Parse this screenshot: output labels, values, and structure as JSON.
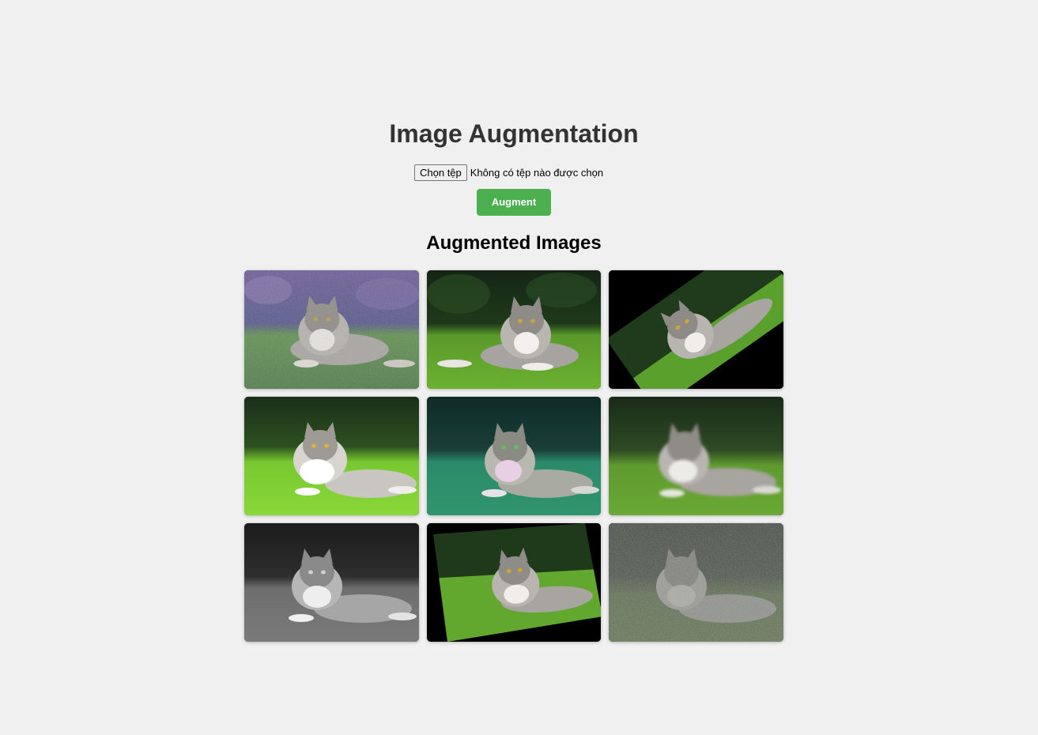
{
  "page": {
    "title": "Image Augmentation",
    "file_input": {
      "button_label": "Chọn tệp",
      "status_text": "Không có tệp nào được chọn"
    },
    "augment_button_label": "Augment",
    "results_heading": "Augmented Images"
  },
  "colors": {
    "background": "#f0f0f0",
    "accent_green": "#4caf50",
    "heading": "#333333"
  },
  "augmented_images": [
    {
      "variant": "color-jitter-noise"
    },
    {
      "variant": "original"
    },
    {
      "variant": "rotation"
    },
    {
      "variant": "brightness"
    },
    {
      "variant": "hue-shift"
    },
    {
      "variant": "blur"
    },
    {
      "variant": "grayscale"
    },
    {
      "variant": "affine-skew"
    },
    {
      "variant": "heavy-noise"
    }
  ]
}
